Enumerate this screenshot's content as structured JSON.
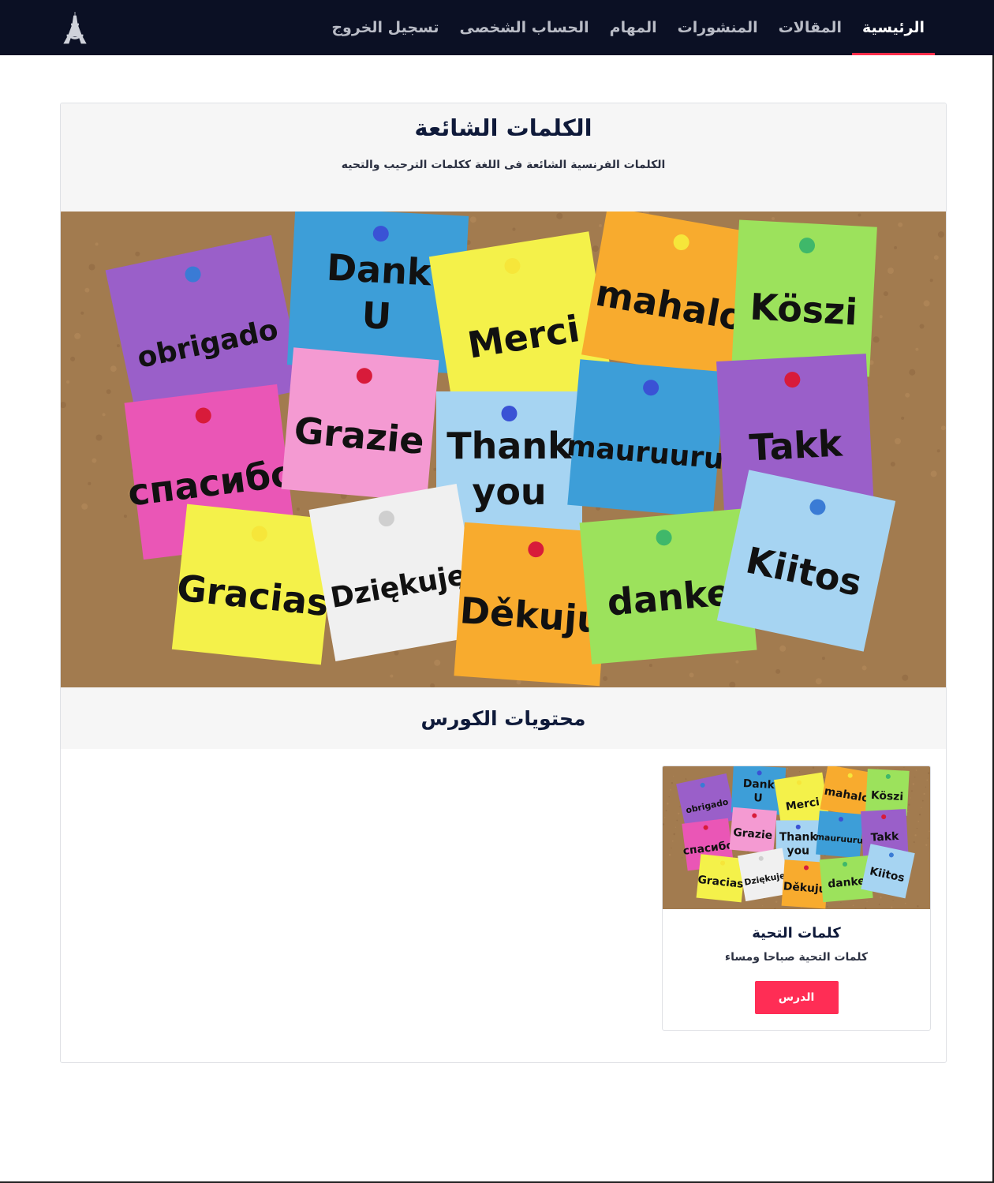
{
  "navbar": {
    "logo_icon": "eiffel-tower-icon",
    "items": [
      {
        "label": "الرئيسية",
        "active": true
      },
      {
        "label": "المقالات",
        "active": false
      },
      {
        "label": "المنشورات",
        "active": false
      },
      {
        "label": "المهام",
        "active": false
      },
      {
        "label": "الحساب الشخصى",
        "active": false
      },
      {
        "label": "تسجيل الخروج",
        "active": false
      }
    ]
  },
  "course": {
    "title": "الكلمات الشائعة",
    "subtitle": "الكلمات الفرنسية الشائعة فى اللغة ككلمات الترحيب والتحيه",
    "contents_heading": "محتويات الكورس",
    "hero_words": [
      "obrigado",
      "Dank U",
      "Merci",
      "mahalo",
      "Köszi",
      "спасибо",
      "Grazie",
      "Thank you",
      "mauruuru",
      "Takk",
      "Gracias",
      "Dziękuję",
      "Děkuju",
      "danke",
      "Kiitos"
    ]
  },
  "lesson": {
    "title": "كلمات التحية",
    "description": "كلمات التحية صباحا ومساء",
    "button_label": "الدرس"
  },
  "colors": {
    "navbar_bg": "#0b1024",
    "accent": "#ff2d55",
    "header_bg": "#f6f6f6"
  }
}
